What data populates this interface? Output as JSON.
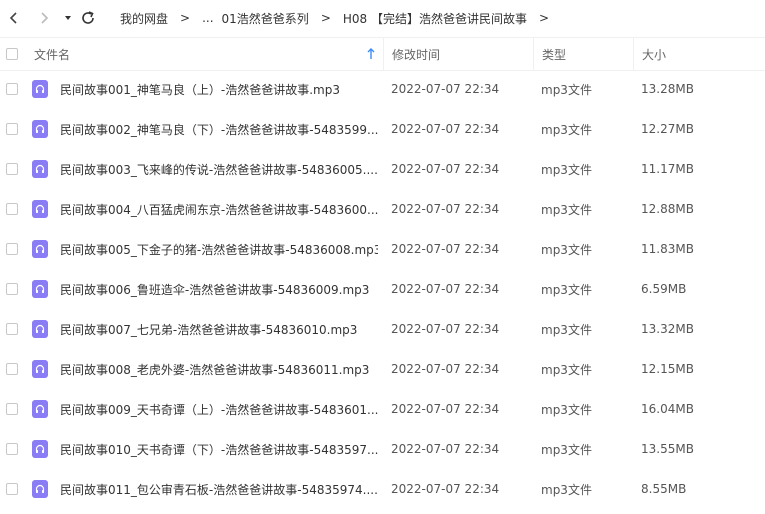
{
  "breadcrumb": {
    "root": "我的网盘",
    "ellipsis": "...",
    "level1": "01浩然爸爸系列",
    "level2": "H08 【完结】浩然爸爸讲民间故事",
    "separator": ">"
  },
  "header": {
    "name": "文件名",
    "mtime": "修改时间",
    "type": "类型",
    "size": "大小"
  },
  "colors": {
    "audio_icon": "#8a7cf5"
  },
  "files": [
    {
      "name": "民间故事001_神笔马良（上）-浩然爸爸讲故事.mp3",
      "mtime": "2022-07-07 22:34",
      "type": "mp3文件",
      "size": "13.28MB"
    },
    {
      "name": "民间故事002_神笔马良（下）-浩然爸爸讲故事-5483599...",
      "mtime": "2022-07-07 22:34",
      "type": "mp3文件",
      "size": "12.27MB"
    },
    {
      "name": "民间故事003_飞来峰的传说-浩然爸爸讲故事-54836005....",
      "mtime": "2022-07-07 22:34",
      "type": "mp3文件",
      "size": "11.17MB"
    },
    {
      "name": "民间故事004_八百猛虎闹东京-浩然爸爸讲故事-5483600...",
      "mtime": "2022-07-07 22:34",
      "type": "mp3文件",
      "size": "12.88MB"
    },
    {
      "name": "民间故事005_下金子的猪-浩然爸爸讲故事-54836008.mp3",
      "mtime": "2022-07-07 22:34",
      "type": "mp3文件",
      "size": "11.83MB"
    },
    {
      "name": "民间故事006_鲁班造伞-浩然爸爸讲故事-54836009.mp3",
      "mtime": "2022-07-07 22:34",
      "type": "mp3文件",
      "size": "6.59MB"
    },
    {
      "name": "民间故事007_七兄弟-浩然爸爸讲故事-54836010.mp3",
      "mtime": "2022-07-07 22:34",
      "type": "mp3文件",
      "size": "13.32MB"
    },
    {
      "name": "民间故事008_老虎外婆-浩然爸爸讲故事-54836011.mp3",
      "mtime": "2022-07-07 22:34",
      "type": "mp3文件",
      "size": "12.15MB"
    },
    {
      "name": "民间故事009_天书奇谭（上）-浩然爸爸讲故事-5483601...",
      "mtime": "2022-07-07 22:34",
      "type": "mp3文件",
      "size": "16.04MB"
    },
    {
      "name": "民间故事010_天书奇谭（下）-浩然爸爸讲故事-5483597...",
      "mtime": "2022-07-07 22:34",
      "type": "mp3文件",
      "size": "13.55MB"
    },
    {
      "name": "民间故事011_包公审青石板-浩然爸爸讲故事-54835974....",
      "mtime": "2022-07-07 22:34",
      "type": "mp3文件",
      "size": "8.55MB"
    }
  ]
}
